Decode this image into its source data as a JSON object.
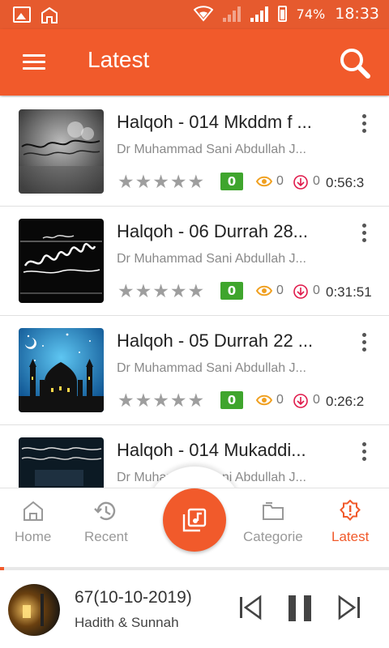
{
  "status_bar": {
    "battery": "74%",
    "time": "18:33"
  },
  "app_bar": {
    "title": "Latest"
  },
  "tracks": [
    {
      "title": "Halqoh - 014 Mkddm f ...",
      "author": "Dr Muhammad Sani Abdullah J...",
      "rating_count": "0",
      "views": "0",
      "downloads": "0",
      "duration": "0:56:3",
      "stars": "★★★★★"
    },
    {
      "title": "Halqoh - 06 Durrah 28...",
      "author": "Dr Muhammad Sani Abdullah J...",
      "rating_count": "0",
      "views": "0",
      "downloads": "0",
      "duration": "0:31:51",
      "stars": "★★★★★"
    },
    {
      "title": "Halqoh - 05 Durrah 22 ...",
      "author": "Dr Muhammad Sani Abdullah J...",
      "rating_count": "0",
      "views": "0",
      "downloads": "0",
      "duration": "0:26:2",
      "stars": "★★★★★"
    },
    {
      "title": "Halqoh - 014 Mukaddi...",
      "author": "Dr Muhammad Sani Abdullah J..."
    }
  ],
  "bottom_nav": {
    "items": [
      {
        "label": "Home"
      },
      {
        "label": "Recent"
      },
      {
        "label": "Categorie"
      },
      {
        "label": "Latest"
      }
    ]
  },
  "player": {
    "title": "67(10-10-2019)",
    "category": "Hadith & Sunnah",
    "progress": 0.01
  },
  "colors": {
    "accent": "#f15a2b",
    "status_bar": "#e65a2e",
    "rating_green": "#3fa52d"
  }
}
